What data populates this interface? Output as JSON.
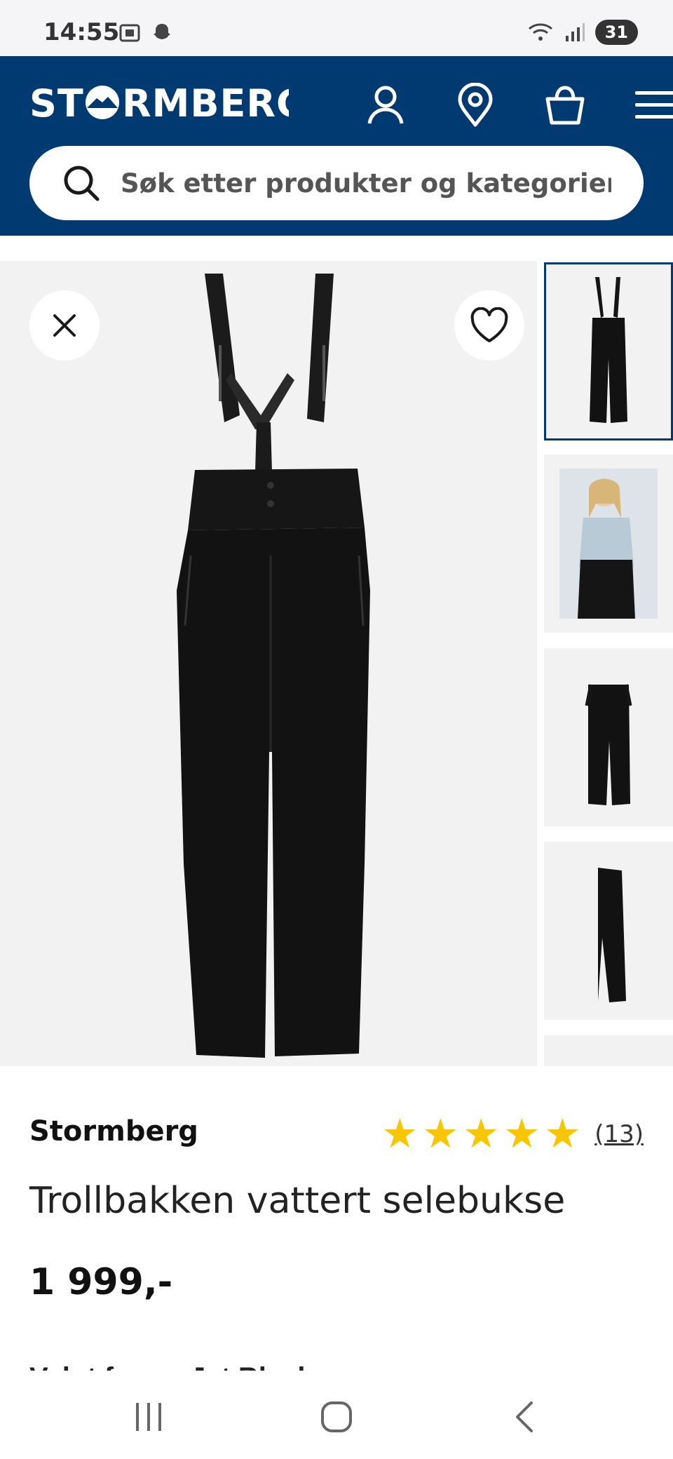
{
  "status_bar": {
    "time": "14:55",
    "battery": "31"
  },
  "header": {
    "logo_text": "STORMBERG",
    "icons": [
      "account-icon",
      "store-location-icon",
      "cart-icon",
      "menu-icon"
    ],
    "brand_color": "#003a70"
  },
  "search": {
    "placeholder": "Søk etter produkter og kategorier"
  },
  "gallery": {
    "thumbnail_count": 5,
    "active_thumbnail": 1
  },
  "product": {
    "brand": "Stormberg",
    "rating_stars": 5,
    "review_count": "(13)",
    "title": "Trollbakken vattert selebukse",
    "price": "1 999,-",
    "partially_visible_line": "Valgt farge: Jet Black"
  },
  "colors": {
    "accent": "#003a70",
    "star": "#f7c600"
  }
}
